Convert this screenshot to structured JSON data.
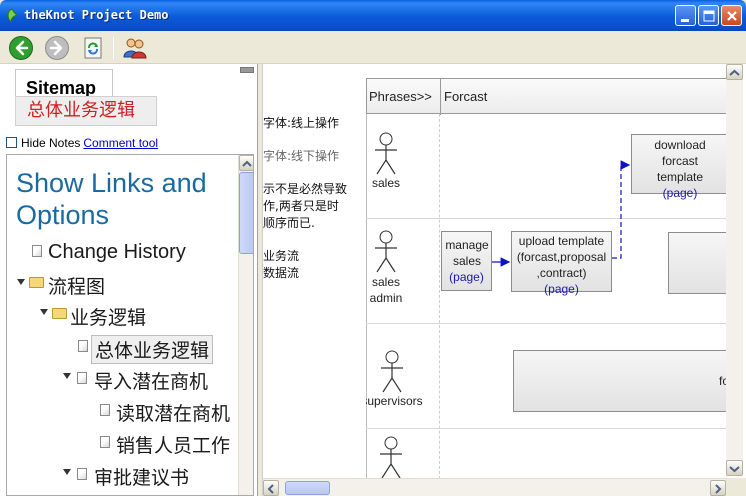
{
  "window": {
    "title": "theKnot Project Demo",
    "buttons": {
      "minimize": "minimize",
      "maximize": "maximize",
      "close": "close"
    }
  },
  "toolbar": {
    "items": [
      {
        "name": "back",
        "icon": "back-arrow-icon"
      },
      {
        "name": "forward",
        "icon": "forward-arrow-icon"
      },
      {
        "name": "refresh",
        "icon": "refresh-icon"
      },
      {
        "name": "users",
        "icon": "users-icon"
      }
    ]
  },
  "sitemap": {
    "tab_label": "Sitemap",
    "page_title": "总体业务逻辑",
    "hide_notes_label": "Hide Notes",
    "comment_tool_label": "Comment tool",
    "show_links_label": "Show Links and Options",
    "tree": [
      {
        "label": "Change History",
        "type": "page"
      },
      {
        "label": "流程图",
        "type": "folder"
      },
      {
        "label": "业务逻辑",
        "type": "folder"
      },
      {
        "label": "总体业务逻辑",
        "type": "page",
        "selected": true
      },
      {
        "label": "导入潜在商机",
        "type": "page"
      },
      {
        "label": "读取潜在商机",
        "type": "page"
      },
      {
        "label": "销售人员工作",
        "type": "page"
      },
      {
        "label": "审批建议书",
        "type": "page"
      }
    ]
  },
  "notes": [
    "字体:线上操作",
    "字体:线下操作",
    "示不是必然导致",
    "作,两者只是时",
    "顺序而已.",
    "业务流",
    "数据流"
  ],
  "diagram": {
    "header_phrases": "Phrases>>",
    "header_stage": "Forcast",
    "actors": [
      "sales",
      "sales admin",
      "supervisors",
      ""
    ],
    "boxes": {
      "download": "download forcast template",
      "manage": "manage sales",
      "upload": "upload template (forcast,proposal ,contract)",
      "partial_text": "fo"
    },
    "page_label": "(page)"
  }
}
